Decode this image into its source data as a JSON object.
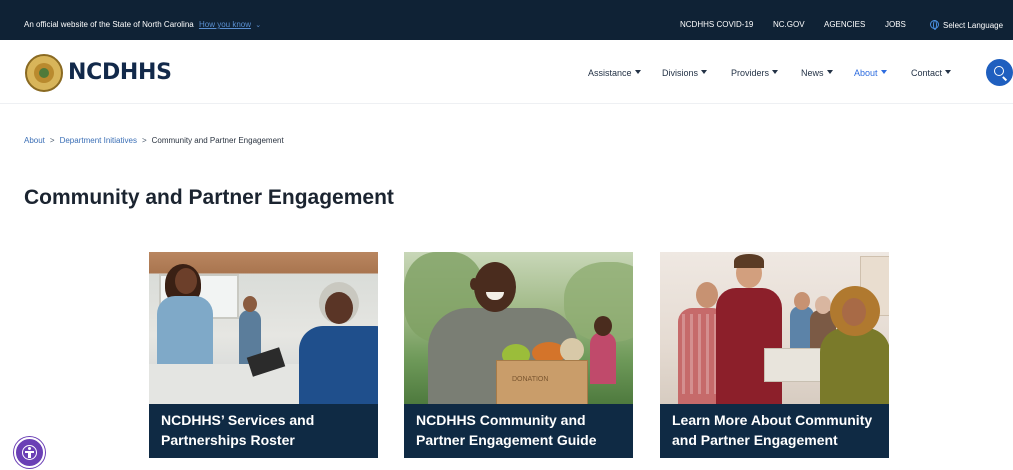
{
  "topbar": {
    "official_text": "An official website of the State of North Carolina",
    "how_you_know": "How you know",
    "links": [
      "NCDHHS COVID-19",
      "NC.GOV",
      "AGENCIES",
      "JOBS"
    ],
    "language": "Select Language"
  },
  "header": {
    "logo_text": "NCDHHS",
    "nav": [
      "Assistance",
      "Divisions",
      "Providers",
      "News",
      "About",
      "Contact"
    ],
    "active_nav": "About"
  },
  "breadcrumb": {
    "items": [
      "About",
      "Department Initiatives"
    ],
    "current": "Community and Partner Engagement",
    "separator": ">"
  },
  "page": {
    "title": "Community and Partner Engagement"
  },
  "cards": [
    {
      "label": "NCDHHS’ Services and Partnerships Roster"
    },
    {
      "label": "NCDHHS Community and Partner Engagement Guide",
      "box_text": "DONATION"
    },
    {
      "label": "Learn More About Community and Partner Engagement"
    }
  ],
  "colors": {
    "topbar_bg": "#0f2235",
    "card_label_bg": "#0f2a44",
    "accent": "#2d6cdf",
    "search_button": "#1f5fbf",
    "accessibility_button": "#6a3fb5"
  },
  "icons": [
    "nc-seal-logo-icon",
    "globe-icon",
    "chevron-down-icon",
    "caret-down-icon",
    "search-icon",
    "accessibility-icon"
  ]
}
